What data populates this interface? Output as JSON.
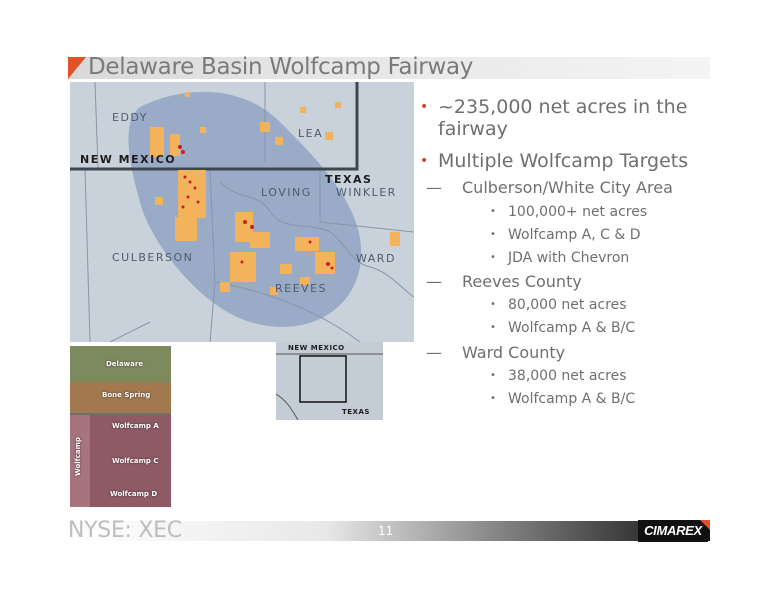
{
  "title": "Delaware Basin Wolfcamp Fairway",
  "map": {
    "labels": {
      "eddy": "EDDY",
      "lea": "LEA",
      "new_mexico": "NEW MEXICO",
      "texas": "TEXAS",
      "loving": "LOVING",
      "winkler": "WINKLER",
      "culberson": "CULBERSON",
      "ward": "WARD",
      "reeves": "REEVES"
    }
  },
  "strat_column": {
    "delaware": "Delaware",
    "bone_spring": "Bone Spring",
    "wolfcamp_a": "Wolfcamp A",
    "wolfcamp_c": "Wolfcamp C",
    "wolfcamp_d": "Wolfcamp D",
    "wolfcamp": "Wolfcamp"
  },
  "inset_map": {
    "new_mexico": "NEW MEXICO",
    "texas": "TEXAS"
  },
  "bullets": {
    "b1": "~235,000 net acres in the fairway",
    "b2": "Multiple Wolfcamp Targets",
    "culberson": {
      "heading": "Culberson/White City Area",
      "items": [
        "100,000+ net acres",
        "Wolfcamp A, C & D",
        "JDA with Chevron"
      ]
    },
    "reeves": {
      "heading": "Reeves County",
      "items": [
        "80,000 net acres",
        "Wolfcamp A & B/C"
      ]
    },
    "ward": {
      "heading": "Ward County",
      "items": [
        "38,000 net acres",
        "Wolfcamp A & B/C"
      ]
    },
    "bullet_glyph": "•",
    "sub_bullet_glyph": "•",
    "dash_glyph": "—"
  },
  "footer": {
    "ticker": "NYSE: XEC",
    "page_number": "11",
    "logo": "CIMAREX"
  },
  "colors": {
    "accent": "#e0522a",
    "fairway": "#8a9ec0",
    "acreage": "#f2b35a",
    "wells": "#c8202a"
  }
}
